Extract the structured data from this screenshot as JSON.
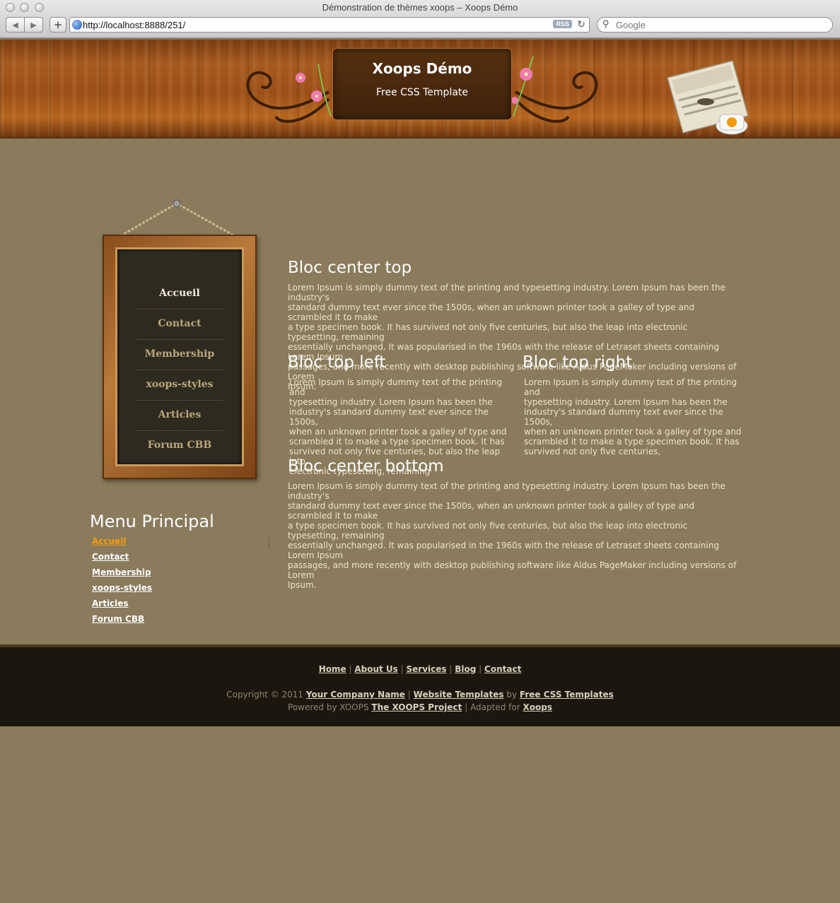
{
  "browser": {
    "window_title": "Démonstration de thèmes xoops – Xoops Démo",
    "url": "http://localhost:8888/251/",
    "rss_badge": "RSS",
    "search_placeholder": "Google"
  },
  "header": {
    "title": "Xoops Démo",
    "slogan": "Free CSS Template"
  },
  "frame_menu": {
    "items": [
      "Accueil",
      "Contact",
      "Membership",
      "xoops-styles",
      "Articles",
      "Forum CBB"
    ],
    "active_index": 0
  },
  "side_menu": {
    "title": "Menu Principal",
    "items": [
      "Accueil",
      "Contact",
      "Membership",
      "xoops-styles",
      "Articles",
      "Forum CBB"
    ],
    "current_index": 0
  },
  "blocks": {
    "center_top": {
      "title": "Bloc center top",
      "lines": [
        "Lorem Ipsum is simply dummy text of the printing and typesetting industry. Lorem Ipsum has been the industry's",
        "standard dummy text ever since the 1500s, when an unknown printer took a galley of type and scrambled it to make",
        "a type specimen book. It has survived not only five centuries, but also the leap into electronic typesetting, remaining",
        "essentially unchanged. It was popularised in the 1960s with the release of Letraset sheets containing Lorem Ipsum",
        "passages, and more recently with desktop publishing software like Aldus PageMaker including versions of Lorem",
        "Ipsum."
      ]
    },
    "top_left": {
      "title": "Bloc top left",
      "lines": [
        "Lorem Ipsum is simply dummy text of the printing and",
        "typesetting industry. Lorem Ipsum has been the",
        "industry's standard dummy text ever since the 1500s,",
        "when an unknown printer took a galley of type and",
        "scrambled it to make a type specimen book. It has",
        "survived not only five centuries, but also the leap into",
        "electronic typesetting, remaining"
      ]
    },
    "top_right": {
      "title": "Bloc top right",
      "lines": [
        "Lorem Ipsum is simply dummy text of the printing and",
        "typesetting industry. Lorem Ipsum has been the",
        "industry's standard dummy text ever since the 1500s,",
        "when an unknown printer took a galley of type and",
        "scrambled it to make a type specimen book. It has",
        "survived not only five centuries,"
      ]
    },
    "center_bottom": {
      "title": "Bloc center bottom",
      "lines": [
        "Lorem Ipsum is simply dummy text of the printing and typesetting industry. Lorem Ipsum has been the industry's",
        "standard dummy text ever since the 1500s, when an unknown printer took a galley of type and scrambled it to make",
        "a type specimen book. It has survived not only five centuries, but also the leap into electronic typesetting, remaining",
        "essentially unchanged. It was popularised in the 1960s with the release of Letraset sheets containing Lorem Ipsum",
        "passages, and more recently with desktop publishing software like Aldus PageMaker including versions of Lorem",
        "Ipsum."
      ]
    }
  },
  "footer": {
    "links": [
      "Home",
      "About Us",
      "Services",
      "Blog",
      "Contact"
    ],
    "copyright_prefix": "Copyright © 2011",
    "company": "Your Company Name",
    "website_templates": "Website Templates",
    "by": "by",
    "free_css": "Free CSS Templates",
    "powered_prefix": "Powered by XOOPS",
    "xoops_project": "The XOOPS Project",
    "adapted": "Adapted for",
    "xoops": "Xoops"
  },
  "colors": {
    "page_bg": "#8a7b5d",
    "current_link": "#f49a10",
    "footer_bg": "#1c170e"
  }
}
